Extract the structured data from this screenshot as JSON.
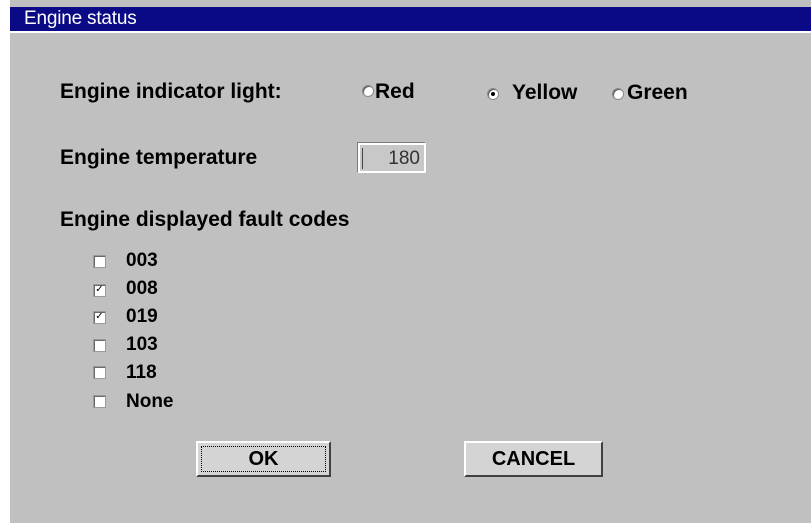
{
  "window": {
    "title": "Engine status"
  },
  "indicator": {
    "label": "Engine indicator light:",
    "options": [
      {
        "label": "Red",
        "selected": false
      },
      {
        "label": "Yellow",
        "selected": true
      },
      {
        "label": "Green",
        "selected": false
      }
    ]
  },
  "temperature": {
    "label": "Engine temperature",
    "value": "180"
  },
  "fault_codes": {
    "label": "Engine displayed fault codes",
    "items": [
      {
        "label": "003",
        "checked": false
      },
      {
        "label": "008",
        "checked": true
      },
      {
        "label": "019",
        "checked": true
      },
      {
        "label": "103",
        "checked": false
      },
      {
        "label": "118",
        "checked": false
      },
      {
        "label": "None",
        "checked": false
      }
    ]
  },
  "buttons": {
    "ok": "OK",
    "cancel": "CANCEL"
  },
  "colors": {
    "titlebar": "#0a0a86",
    "dialog_bg": "#c0c0c0"
  }
}
